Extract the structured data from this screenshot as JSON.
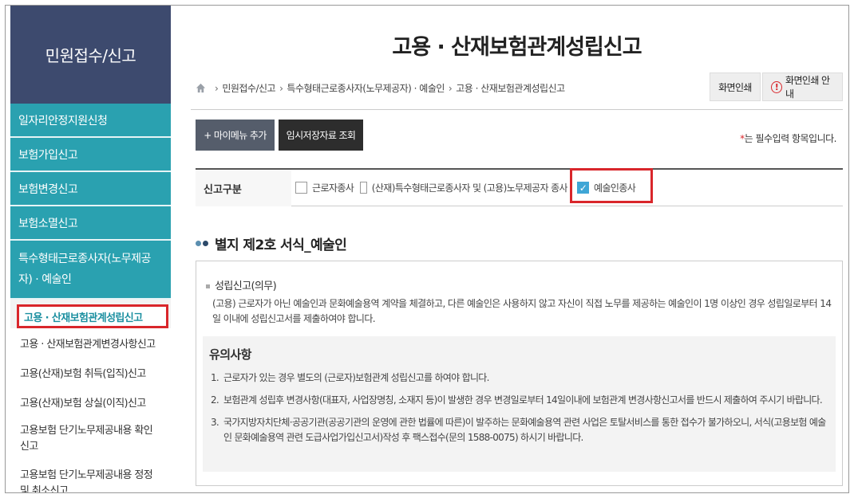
{
  "sidebar": {
    "title": "민원접수/신고",
    "items": [
      {
        "label": "일자리안정지원신청"
      },
      {
        "label": "보험가입신고"
      },
      {
        "label": "보험변경신고"
      },
      {
        "label": "보험소멸신고"
      },
      {
        "label": "특수형태근로종사자(노무제공자) · 예술인"
      }
    ],
    "subitems": [
      {
        "label": "고용 · 산재보험관계성립신고",
        "active": true
      },
      {
        "label": "고용 · 산재보험관계변경사항신고"
      },
      {
        "label": "고용(산재)보험 취득(입직)신고"
      },
      {
        "label": "고용(산재)보험 상실(이직)신고"
      },
      {
        "label": "고용보험 단기노무제공내용 확인신고"
      },
      {
        "label": "고용보험 단기노무제공내용 정정 및 취소신고"
      }
    ]
  },
  "header": {
    "title": "고용 · 산재보험관계성립신고",
    "breadcrumb": [
      "민원접수/신고",
      "특수형태근로종사자(노무제공자) · 예술인",
      "고용 · 산재보험관계성립신고"
    ],
    "print_label": "화면인쇄",
    "print_guide_label": "화면인쇄 안내"
  },
  "toolbar": {
    "mymenu_label": "+ 마이메뉴 추가",
    "temp_label": "임시저장자료 조회",
    "required_star": "*",
    "required_text": "는 필수입력 항목입니다."
  },
  "form": {
    "label": "신고구분",
    "options": [
      {
        "label": "근로자종사",
        "checked": false
      },
      {
        "label": "(산재)특수형태근로종사자 및 (고용)노무제공자 종사",
        "checked": false
      },
      {
        "label": "예술인종사",
        "checked": true
      }
    ]
  },
  "section": {
    "title": "별지 제2호 서식_예술인",
    "info_head": "성립신고(의무)",
    "info_body": "(고용) 근로자가 아닌 예술인과 문화예술용역 계약을 체결하고, 다른 예술인은 사용하지 않고 자신이 직접 노무를 제공하는 예술인이 1명 이상인 경우 성립일로부터 14일 이내에 성립신고서를 제출하여야 합니다.",
    "notice_title": "유의사항",
    "notices": [
      {
        "num": "1.",
        "text": "근로자가 있는 경우 별도의 (근로자)보험관계 성립신고를 하여야 합니다."
      },
      {
        "num": "2.",
        "text": "보험관계 성립후 변경사항(대표자, 사업장명칭, 소재지 등)이 발생한 경우 변경일로부터 14일이내에 보험관계 변경사항신고서를 반드시 제출하여 주시기 바랍니다."
      },
      {
        "num": "3.",
        "text": "국가지방자치단체·공공기관(공공기관의 운영에 관한 법률에 따른)이 발주하는 문화예술용역 관련 사업은 토탈서비스를 통한 접수가 불가하오니, 서식(고용보험 예술인 문화예술용역 관련 도급사업가입신고서)작성 후 팩스접수(문의 1588-0075) 하시기 바랍니다."
      }
    ]
  }
}
